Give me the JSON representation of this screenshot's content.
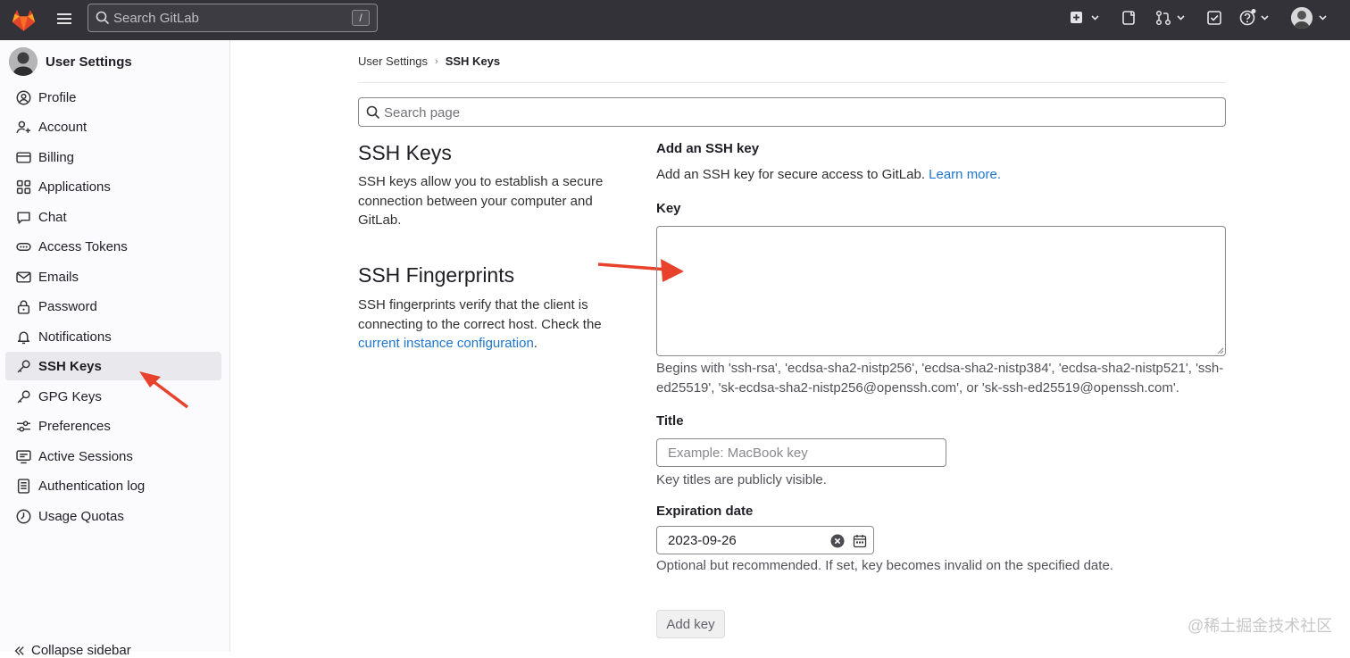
{
  "topbar": {
    "search_placeholder": "Search GitLab",
    "search_shortcut": "/"
  },
  "sidebar": {
    "title": "User Settings",
    "items": [
      {
        "label": "Profile",
        "icon": "profile-icon"
      },
      {
        "label": "Account",
        "icon": "account-icon"
      },
      {
        "label": "Billing",
        "icon": "billing-icon"
      },
      {
        "label": "Applications",
        "icon": "applications-icon"
      },
      {
        "label": "Chat",
        "icon": "chat-icon"
      },
      {
        "label": "Access Tokens",
        "icon": "token-icon"
      },
      {
        "label": "Emails",
        "icon": "email-icon"
      },
      {
        "label": "Password",
        "icon": "lock-icon"
      },
      {
        "label": "Notifications",
        "icon": "bell-icon"
      },
      {
        "label": "SSH Keys",
        "icon": "key-icon",
        "active": true
      },
      {
        "label": "GPG Keys",
        "icon": "key-icon"
      },
      {
        "label": "Preferences",
        "icon": "preferences-icon"
      },
      {
        "label": "Active Sessions",
        "icon": "monitor-icon"
      },
      {
        "label": "Authentication log",
        "icon": "log-icon"
      },
      {
        "label": "Usage Quotas",
        "icon": "quota-icon"
      }
    ],
    "collapse_label": "Collapse sidebar"
  },
  "breadcrumb": {
    "parent": "User Settings",
    "current": "SSH Keys"
  },
  "page_search_placeholder": "Search page",
  "left": {
    "ssh_title": "SSH Keys",
    "ssh_desc": "SSH keys allow you to establish a secure connection between your computer and GitLab.",
    "fp_title": "SSH Fingerprints",
    "fp_desc_1": "SSH fingerprints verify that the client is connecting to the correct host. Check the",
    "fp_link": "current instance configuration",
    "fp_desc_end": "."
  },
  "form": {
    "heading": "Add an SSH key",
    "intro": "Add an SSH key for secure access to GitLab.",
    "learn_more": "Learn more.",
    "key_label": "Key",
    "key_help": "Begins with 'ssh-rsa', 'ecdsa-sha2-nistp256', 'ecdsa-sha2-nistp384', 'ecdsa-sha2-nistp521', 'ssh-ed25519', 'sk-ecdsa-sha2-nistp256@openssh.com', or 'sk-ssh-ed25519@openssh.com'.",
    "title_label": "Title",
    "title_placeholder": "Example: MacBook key",
    "title_help": "Key titles are publicly visible.",
    "expiry_label": "Expiration date",
    "expiry_value": "2023-09-26",
    "expiry_help": "Optional but recommended. If set, key becomes invalid on the specified date.",
    "submit": "Add key"
  },
  "watermark": "@稀土掘金技术社区",
  "colors": {
    "topbar": "#333238",
    "link": "#1f75cb",
    "arrow": "#e8412c"
  }
}
